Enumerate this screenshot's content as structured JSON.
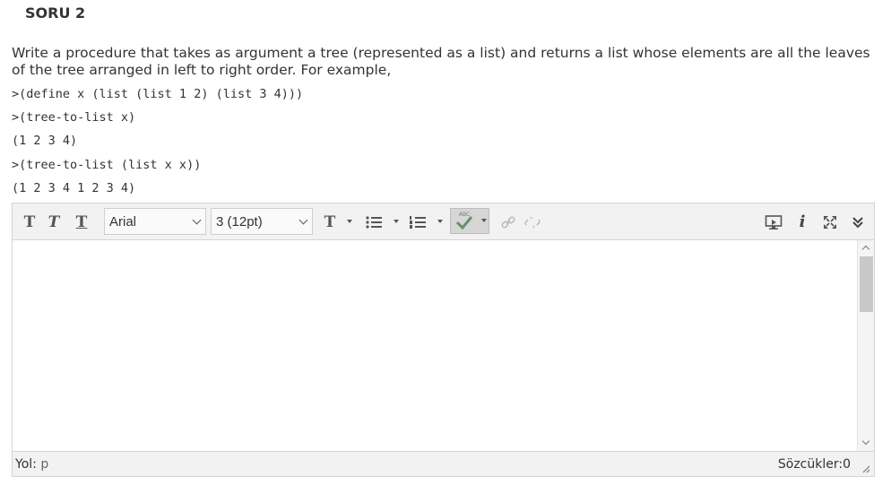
{
  "question": {
    "title": "SORU 2",
    "text": "Write a procedure that takes as argument a tree (represented as a list) and returns a list whose elements are all the leaves of the tree arranged in left to right order. For example,",
    "code": [
      ">(define x (list (list 1 2) (list 3 4)))",
      ">(tree-to-list x)",
      "(1 2 3 4)",
      ">(tree-to-list (list x x))",
      "(1 2 3 4 1 2 3 4)"
    ]
  },
  "toolbar": {
    "font_family": "Arial",
    "font_size": "3 (12pt)",
    "spell_label": "ABC",
    "icons": [
      "bold-icon",
      "italic-icon",
      "underline-icon",
      "text-color-icon",
      "bullet-list-icon",
      "numbered-list-icon",
      "spellcheck-icon",
      "link-icon",
      "unlink-icon",
      "preview-icon",
      "info-icon",
      "fullscreen-icon",
      "expand-toolbar-icon"
    ],
    "info_glyph": "i"
  },
  "editor": {
    "content": ""
  },
  "status": {
    "path_label": "Yol:",
    "path_value": "p",
    "word_count": "Sözcükler:0"
  }
}
